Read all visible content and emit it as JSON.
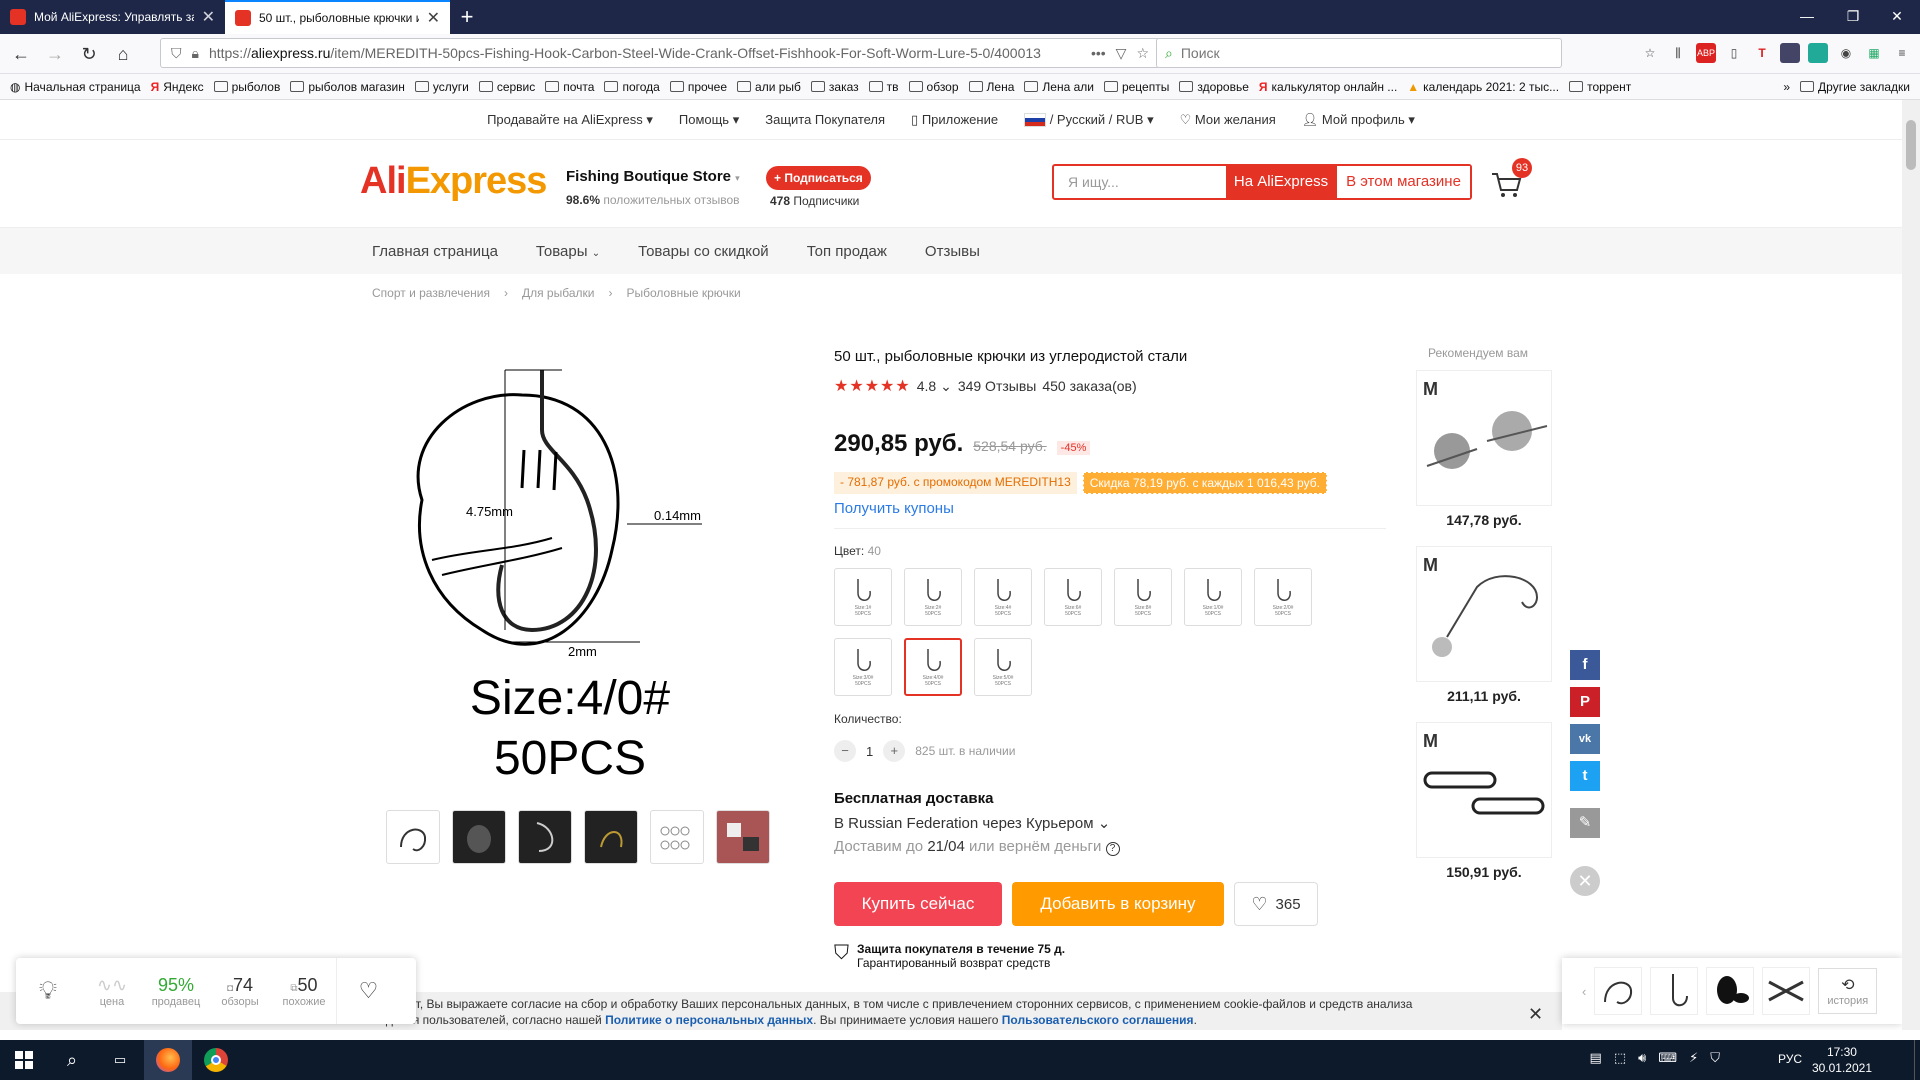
{
  "browser": {
    "tabs": [
      {
        "label": "Мой AliExpress: Управлять зак",
        "active": false
      },
      {
        "label": "50 шт., рыболовные крючки и",
        "active": true
      }
    ],
    "url_prefix": "https://",
    "url_host": "aliexpress.ru",
    "url_path": "/item/MEREDITH-50pcs-Fishing-Hook-Carbon-Steel-Wide-Crank-Offset-Fishhook-For-Soft-Worm-Lure-5-0/400013",
    "search_placeholder": "Поиск",
    "bookmarks": [
      "Начальная страница",
      "Яндекс",
      "рыболов",
      "рыболов магазин",
      "услуги",
      "сервис",
      "почта",
      "погода",
      "прочее",
      "али рыб",
      "заказ",
      "тв",
      "обзор",
      "Лена",
      "Лена али",
      "рецепты",
      "здоровье",
      "калькулятор онлайн ...",
      "календарь 2021: 2 тыс...",
      "торрент"
    ],
    "other_bookmarks": "Другие закладки"
  },
  "topline": {
    "sell": "Продавайте на AliExpress",
    "help": "Помощь",
    "protection": "Защита Покупателя",
    "app": "Приложение",
    "lang": "/ Русский /  RUB",
    "wishlist": "Мои желания",
    "profile": "Мой профиль"
  },
  "header": {
    "logo_a": "Ali",
    "logo_b": "Express",
    "store_name": "Fishing Boutique Store",
    "positive_pct": "98.6%",
    "positive_label": "положительных отзывов",
    "subscribe": "+ Подписаться",
    "subscribers_count": "478",
    "subscribers_label": "Подписчики",
    "search_placeholder": "Я ищу...",
    "search_btn_all": "На AliExpress",
    "search_btn_store": "В этом магазине",
    "cart_count": "93"
  },
  "catnav": [
    "Главная страница",
    "Товары",
    "Товары со скидкой",
    "Топ продаж",
    "Отзывы"
  ],
  "breadcrumbs": [
    "Спорт и развлечения",
    "Для рыбалки",
    "Рыболовные крючки"
  ],
  "gallery": {
    "size_text": "Size:4/0#",
    "pcs_text": "50PCS",
    "dim1": "4.75mm",
    "dim2": "0.14mm",
    "dim3": "2mm"
  },
  "product": {
    "title": "50 шт., рыболовные крючки из углеродистой стали",
    "rating": "4.8",
    "reviews": "349 Отзывы",
    "orders": "450 заказа(ов)",
    "price": "290,85 руб.",
    "old_price": "528,54 руб.",
    "discount": "-45%",
    "promo1": "- 781,87 руб. с промокодом MEREDITH13",
    "promo2": "Скидка 78,19 руб. с каждых 1 016,43 руб.",
    "coupons": "Получить купоны",
    "color_label": "Цвет:",
    "color_count": "40",
    "swatches": [
      "Size:1#",
      "Size:2#",
      "Size:4#",
      "Size:6#",
      "Size:8#",
      "Size:1/0#",
      "Size:2/0#",
      "Size:3/0#",
      "Size:4/0#",
      "Size:5/0#"
    ],
    "swatch_sub": "50PCS",
    "qty_label": "Количество:",
    "qty": "1",
    "stock": "825 шт. в наличии",
    "ship_title": "Бесплатная доставка",
    "ship_to": "В Russian Federation через Курьером",
    "deliver_pre": "Доставим до",
    "deliver_date": "21/04",
    "deliver_post": "или вернём деньги",
    "buy_now": "Купить сейчас",
    "add_cart": "Добавить в корзину",
    "wish_count": "365",
    "protect_title": "Защита покупателя в течение 75 д.",
    "protect_sub": "Гарантированный возврат средств"
  },
  "recommended": {
    "title": "Рекомендуем вам",
    "items": [
      {
        "price": "147,78 руб."
      },
      {
        "price": "211,11 руб."
      },
      {
        "price": "150,91 руб."
      }
    ]
  },
  "stats": [
    {
      "value": "",
      "label": "цена"
    },
    {
      "value": "95%",
      "label": "продавец"
    },
    {
      "value": "74",
      "label": "обзоры"
    },
    {
      "value": "50",
      "label": "похожие"
    }
  ],
  "history_label": "история",
  "cookie": {
    "text1": "я этот сайт, Вы выражаете согласие на сбор и обработку Ваших персональных данных, в том числе с привлечением сторонних сервисов, с применением cookie-файлов и средств анализа",
    "text2": "поведения пользователей, согласно нашей",
    "link1": "Политике о персональных данных",
    "text3": ". Вы принимаете условия нашего",
    "link2": "Пользовательского соглашения",
    "text4": "."
  },
  "taskbar": {
    "lang": "РУС",
    "time": "17:30",
    "date": "30.01.2021"
  }
}
